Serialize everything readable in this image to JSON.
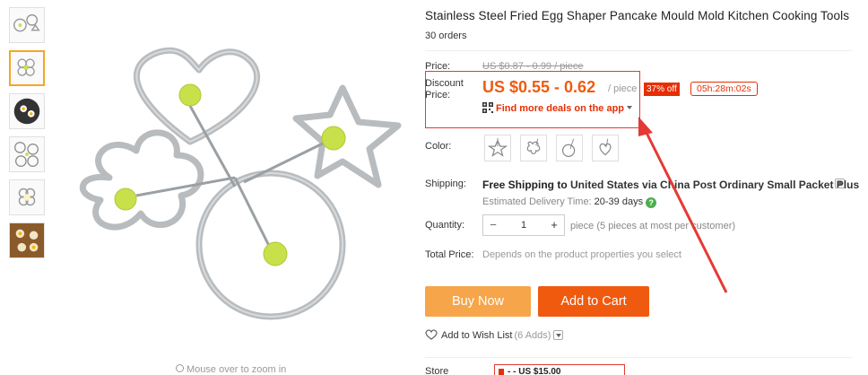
{
  "product": {
    "title": "Stainless Steel Fried Egg Shaper Pancake Mould Mold Kitchen Cooking Tools",
    "orders": "30 orders"
  },
  "gallery": {
    "thumbnails": [
      "egg shapes set",
      "flower shape",
      "pan with eggs",
      "shapes with pins",
      "flower mould",
      "cooked eggs"
    ],
    "zoom_hint": "Mouse over to zoom in"
  },
  "price": {
    "label": "Price:",
    "original": "US $0.87 - 0.99 / piece",
    "discount_label": "Discount Price:",
    "discount_value": "US $0.55 - 0.62",
    "unit": "/ piece",
    "off_badge": "37% off",
    "timer": "05h:28m:02s",
    "app_deals": "Find more deals on the app"
  },
  "color": {
    "label": "Color:",
    "options": [
      "star",
      "flower",
      "circle",
      "heart"
    ]
  },
  "shipping": {
    "label": "Shipping:",
    "free_text": "Free Shipping to",
    "destination": "United States via China Post Ordinary Small Packet Plus",
    "delivery_label": "Estimated Delivery Time:",
    "delivery_days": "20-39 days"
  },
  "quantity": {
    "label": "Quantity:",
    "value": "1",
    "note": "piece (5 pieces at most per customer)"
  },
  "total": {
    "label": "Total Price:",
    "note": "Depends on the product properties you select"
  },
  "actions": {
    "buy_now": "Buy Now",
    "add_to_cart": "Add to Cart",
    "wish_list": "Add to Wish List",
    "wish_count": "(6 Adds)"
  },
  "store": {
    "label": "Store",
    "coupon": "- - US $15.00"
  },
  "colors": {
    "accent_orange": "#f05a0f",
    "buy_now": "#f6a54a",
    "annotation_red": "#e53935"
  }
}
